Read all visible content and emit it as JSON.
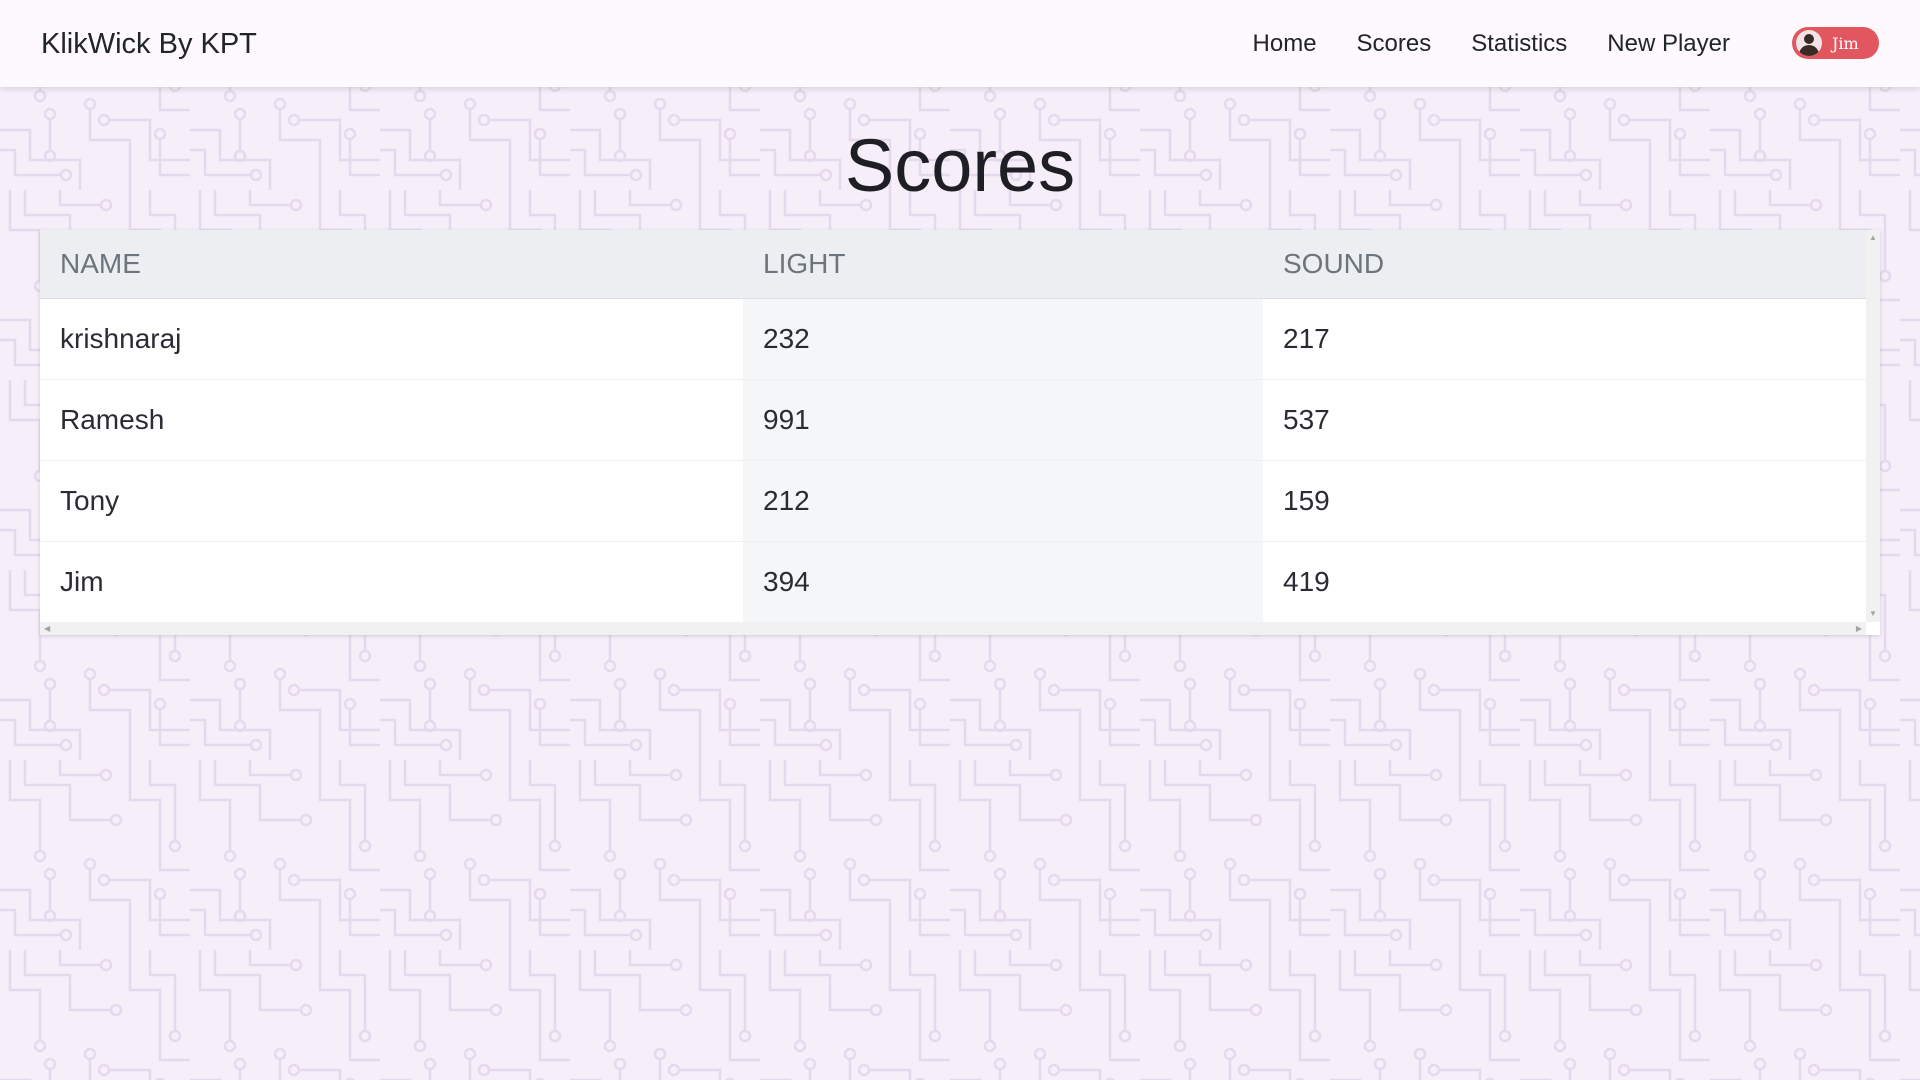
{
  "navbar": {
    "brand": "KlikWick By KPT",
    "links": [
      "Home",
      "Scores",
      "Statistics",
      "New Player"
    ],
    "user": {
      "name": "Jim"
    }
  },
  "page": {
    "title": "Scores"
  },
  "table": {
    "columns": [
      "NAME",
      "LIGHT",
      "SOUND"
    ],
    "rows": [
      [
        "krishnaraj",
        "232",
        "217"
      ],
      [
        "Ramesh",
        "991",
        "537"
      ],
      [
        "Tony",
        "212",
        "159"
      ],
      [
        "Jim",
        "394",
        "419"
      ]
    ]
  },
  "colors": {
    "user_pill": "#e2565f",
    "background": "#f6eef9",
    "circuit_lines": "#e6d9ee"
  },
  "icons": {
    "avatar": "user-avatar-icon",
    "scroll_left": "scroll-left-arrow",
    "scroll_right": "scroll-right-arrow",
    "scroll_up": "scroll-up-arrow",
    "scroll_down": "scroll-down-arrow"
  }
}
